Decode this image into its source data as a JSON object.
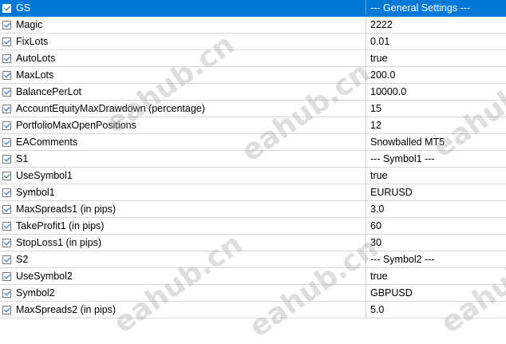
{
  "rows": [
    {
      "name": "GS",
      "value": "--- General Settings ---",
      "selected": true
    },
    {
      "name": "Magic",
      "value": "2222"
    },
    {
      "name": "FixLots",
      "value": "0.01"
    },
    {
      "name": "AutoLots",
      "value": "true"
    },
    {
      "name": "MaxLots",
      "value": "200.0"
    },
    {
      "name": "BalancePerLot",
      "value": "10000.0"
    },
    {
      "name": "AccountEquityMaxDrawdown (percentage)",
      "value": "15"
    },
    {
      "name": "PortfolioMaxOpenPositions",
      "value": "12"
    },
    {
      "name": "EAComments",
      "value": "Snowballed MT5"
    },
    {
      "name": "S1",
      "value": "--- Symbol1 ---"
    },
    {
      "name": "UseSymbol1",
      "value": "true"
    },
    {
      "name": "Symbol1",
      "value": "EURUSD"
    },
    {
      "name": "MaxSpreads1 (in pips)",
      "value": "3.0"
    },
    {
      "name": "TakeProfit1 (in pips)",
      "value": "60"
    },
    {
      "name": "StopLoss1 (in pips)",
      "value": "30"
    },
    {
      "name": "S2",
      "value": "--- Symbol2 ---"
    },
    {
      "name": "UseSymbol2",
      "value": "true"
    },
    {
      "name": "Symbol2",
      "value": "GBPUSD"
    },
    {
      "name": "MaxSpreads2 (in pips)",
      "value": "5.0"
    }
  ],
  "watermark": "eahub.cn",
  "colors": {
    "selected_bg": "#0078d7",
    "grid_line": "#d8d8d8"
  }
}
